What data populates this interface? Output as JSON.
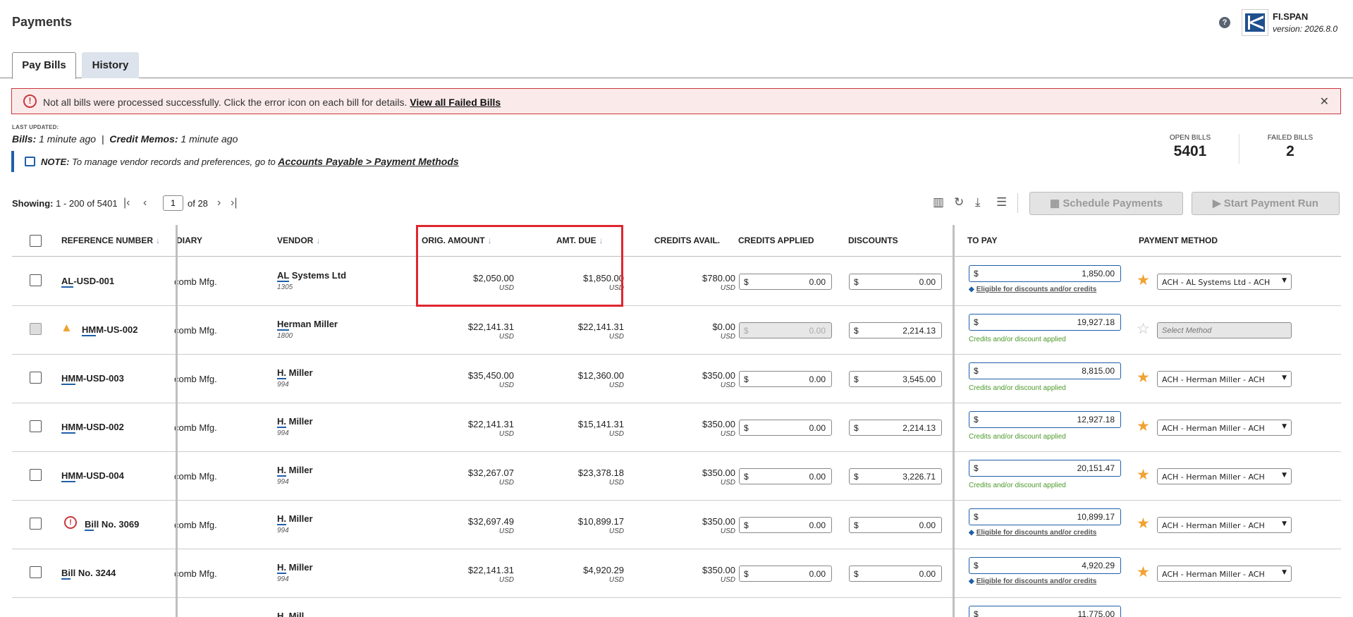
{
  "header": {
    "title": "Payments",
    "brand_name": "FI.SPAN",
    "version": "version: 2026.8.0"
  },
  "tabs": [
    {
      "label": "Pay Bills",
      "active": true
    },
    {
      "label": "History",
      "active": false
    }
  ],
  "alert": {
    "message": "Not all bills were processed successfully. Click the error icon on each bill for details.",
    "link": "View all Failed Bills",
    "close": "✕"
  },
  "last_updated": {
    "label": "LAST UPDATED:",
    "bills_label": "Bills:",
    "bills_value": "1 minute ago",
    "separator": "|",
    "credit_label": "Credit Memos:",
    "credit_value": "1 minute ago"
  },
  "note": {
    "label": "NOTE:",
    "text": "To manage vendor records and preferences, go to",
    "link": "Accounts Payable > Payment Methods"
  },
  "stats": {
    "open_label": "OPEN BILLS",
    "open_value": "5401",
    "failed_label": "FAILED BILLS",
    "failed_value": "2"
  },
  "pager": {
    "showing_label": "Showing:",
    "showing_value": "1 - 200 of 5401",
    "page": "1",
    "of_pages": "of 28"
  },
  "actions": {
    "schedule": "Schedule Payments",
    "start_run": "Start Payment Run"
  },
  "columns": {
    "ref": "REFERENCE NUMBER",
    "diary": "DIARY",
    "vendor": "VENDOR",
    "orig": "ORIG. AMOUNT",
    "due": "AMT. DUE",
    "credits_avail": "CREDITS AVAIL.",
    "credits_applied": "CREDITS APPLIED",
    "discounts": "DISCOUNTS",
    "to_pay": "TO PAY",
    "method": "PAYMENT METHOD"
  },
  "currency_symbol": "$",
  "rows": [
    {
      "ref_u": "AL",
      "ref_rest": "-USD-001",
      "diary": "comb Mfg.",
      "vendor_u": "AL",
      "vendor_rest": " Systems Ltd",
      "vendor_id": "1305",
      "orig": "$2,050.00",
      "orig_cur": "USD",
      "due": "$1,850.00",
      "due_cur": "USD",
      "credits": "$780.00",
      "credits_cur": "USD",
      "applied": "0.00",
      "discount": "0.00",
      "to_pay": "1,850.00",
      "note": "Eligible for discounts and/or credits",
      "method": "ACH - AL Systems Ltd - ACH"
    },
    {
      "ref_u": "HM",
      "ref_rest": "M-US-002",
      "diary": "comb Mfg.",
      "vendor_u": "He",
      "vendor_rest": "rman Miller",
      "vendor_id": "1800",
      "orig": "$22,141.31",
      "orig_cur": "USD",
      "due": "$22,141.31",
      "due_cur": "USD",
      "credits": "$0.00",
      "credits_cur": "USD",
      "applied": "0.00",
      "discount": "2,214.13",
      "to_pay": "19,927.18",
      "note": "Credits and/or discount applied",
      "method": "Select Method"
    },
    {
      "ref_u": "HM",
      "ref_rest": "M-USD-003",
      "diary": "comb Mfg.",
      "vendor_u": "H.",
      "vendor_rest": " Miller",
      "vendor_id": "994",
      "orig": "$35,450.00",
      "orig_cur": "USD",
      "due": "$12,360.00",
      "due_cur": "USD",
      "credits": "$350.00",
      "credits_cur": "USD",
      "applied": "0.00",
      "discount": "3,545.00",
      "to_pay": "8,815.00",
      "note": "Credits and/or discount applied",
      "method": "ACH - Herman Miller - ACH"
    },
    {
      "ref_u": "HM",
      "ref_rest": "M-USD-002",
      "diary": "comb Mfg.",
      "vendor_u": "H.",
      "vendor_rest": " Miller",
      "vendor_id": "994",
      "orig": "$22,141.31",
      "orig_cur": "USD",
      "due": "$15,141.31",
      "due_cur": "USD",
      "credits": "$350.00",
      "credits_cur": "USD",
      "applied": "0.00",
      "discount": "2,214.13",
      "to_pay": "12,927.18",
      "note": "Credits and/or discount applied",
      "method": "ACH - Herman Miller - ACH"
    },
    {
      "ref_u": "HM",
      "ref_rest": "M-USD-004",
      "diary": "comb Mfg.",
      "vendor_u": "H.",
      "vendor_rest": " Miller",
      "vendor_id": "994",
      "orig": "$32,267.07",
      "orig_cur": "USD",
      "due": "$23,378.18",
      "due_cur": "USD",
      "credits": "$350.00",
      "credits_cur": "USD",
      "applied": "0.00",
      "discount": "3,226.71",
      "to_pay": "20,151.47",
      "note": "Credits and/or discount applied",
      "method": "ACH - Herman Miller - ACH"
    },
    {
      "ref_u": "Bi",
      "ref_rest": "ll No. 3069",
      "diary": "comb Mfg.",
      "vendor_u": "H.",
      "vendor_rest": " Miller",
      "vendor_id": "994",
      "orig": "$32,697.49",
      "orig_cur": "USD",
      "due": "$10,899.17",
      "due_cur": "USD",
      "credits": "$350.00",
      "credits_cur": "USD",
      "applied": "0.00",
      "discount": "0.00",
      "to_pay": "10,899.17",
      "note": "Eligible for discounts and/or credits",
      "method": "ACH - Herman Miller - ACH"
    },
    {
      "ref_u": "Bi",
      "ref_rest": "ll No. 3244",
      "diary": "comb Mfg.",
      "vendor_u": "H.",
      "vendor_rest": " Miller",
      "vendor_id": "994",
      "orig": "$22,141.31",
      "orig_cur": "USD",
      "due": "$4,920.29",
      "due_cur": "USD",
      "credits": "$350.00",
      "credits_cur": "USD",
      "applied": "0.00",
      "discount": "0.00",
      "to_pay": "4,920.29",
      "note": "Eligible for discounts and/or credits",
      "method": "ACH - Herman Miller - ACH"
    }
  ],
  "partial_row": {
    "vendor": "H. Mill",
    "to_pay": "11,775.00"
  },
  "icons": {
    "help": "?",
    "alert_error": "!",
    "row_error": "!",
    "warning": "▲",
    "star": "★",
    "star_empty": "☆",
    "tag": "◆",
    "caret": "▼",
    "first": "|‹",
    "prev": "‹",
    "next": "›",
    "last": "›|",
    "columns": "▥",
    "refresh": "↻",
    "download": "⤓",
    "filter": "☰",
    "calendar": "▦",
    "play": "▶",
    "sort": "↓"
  },
  "colors": {
    "accent": "#1f5fa8",
    "error": "#c8383c",
    "star": "#f0a233",
    "success": "#4c9a2a",
    "highlight": "#e0262f"
  }
}
